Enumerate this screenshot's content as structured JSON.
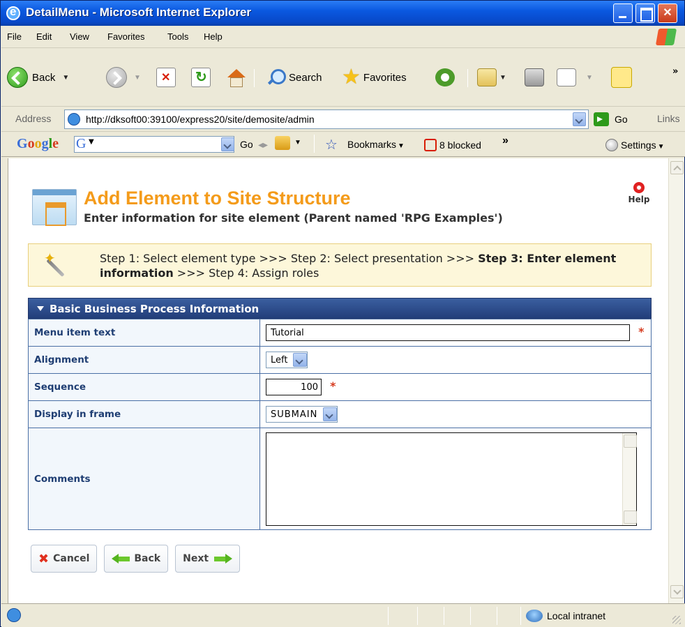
{
  "window": {
    "title": "DetailMenu - Microsoft Internet Explorer"
  },
  "menubar": {
    "items": [
      "File",
      "Edit",
      "View",
      "Favorites",
      "Tools",
      "Help"
    ]
  },
  "toolbar": {
    "back_label": "Back",
    "search_label": "Search",
    "favorites_label": "Favorites"
  },
  "addressbar": {
    "label": "Address",
    "url": "http://dksoft00:39100/express20/site/demosite/admin",
    "go_label": "Go",
    "links_label": "Links"
  },
  "googlebar": {
    "logo": "Google",
    "go_label": "Go",
    "bookmarks_label": "Bookmarks",
    "blocked_label": "8 blocked",
    "more_label": "»",
    "settings_label": "Settings"
  },
  "page": {
    "title": "Add Element to Site Structure",
    "subtitle": "Enter information for site element (Parent named 'RPG Examples')",
    "help_label": "Help",
    "steps": {
      "step1": "Step 1: Select element type >>> Step 2: Select presentation >>> ",
      "step3": "Step 3: Enter element information",
      "step4": " >>> Step 4: Assign roles"
    },
    "form": {
      "section_title": "Basic Business Process Information",
      "menu_item_text_label": "Menu item text",
      "menu_item_text_value": "Tutorial",
      "alignment_label": "Alignment",
      "alignment_value": "Left",
      "sequence_label": "Sequence",
      "sequence_value": "100",
      "display_in_frame_label": "Display in frame",
      "display_in_frame_value": "SUBMAIN",
      "comments_label": "Comments",
      "comments_value": "",
      "required_mark": "*"
    },
    "buttons": {
      "cancel": "Cancel",
      "back": "Back",
      "next": "Next"
    }
  },
  "statusbar": {
    "zone": "Local intranet"
  },
  "colors": {
    "accent_title": "#f49b1a",
    "section_header": "#2d4c8a",
    "label_text": "#1f3e73",
    "required": "#d63b1f"
  }
}
